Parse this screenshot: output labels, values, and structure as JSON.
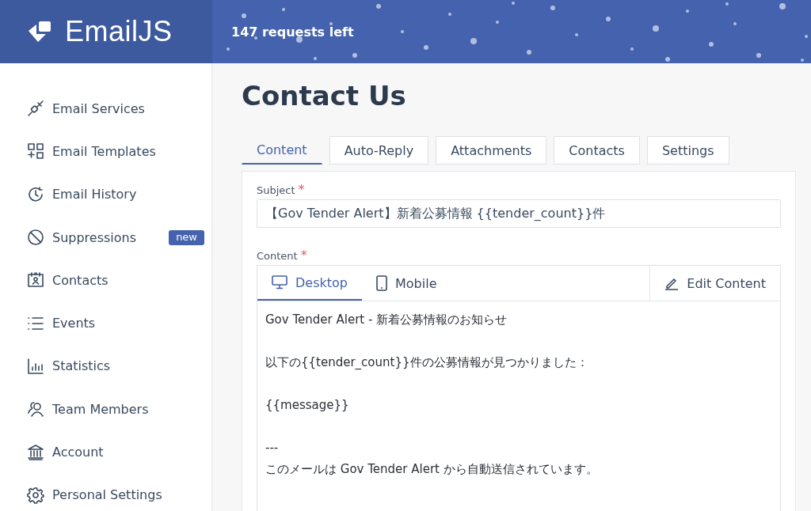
{
  "header": {
    "brand": "EmailJS",
    "requests": "147 requests left"
  },
  "sidebar": {
    "items": [
      {
        "kind": "plug",
        "label": "Email Services"
      },
      {
        "kind": "templates",
        "label": "Email Templates"
      },
      {
        "kind": "history",
        "label": "Email History"
      },
      {
        "kind": "ban",
        "label": "Suppressions",
        "badge": "new"
      },
      {
        "kind": "contacts",
        "label": "Contacts"
      },
      {
        "kind": "list",
        "label": "Events"
      },
      {
        "kind": "chart",
        "label": "Statistics"
      },
      {
        "kind": "team",
        "label": "Team Members"
      },
      {
        "kind": "bank",
        "label": "Account"
      },
      {
        "kind": "gear",
        "label": "Personal Settings"
      }
    ]
  },
  "page": {
    "title": "Contact Us"
  },
  "tabs": [
    {
      "label": "Content",
      "selected": true
    },
    {
      "label": "Auto-Reply",
      "selected": false
    },
    {
      "label": "Attachments",
      "selected": false
    },
    {
      "label": "Contacts",
      "selected": false
    },
    {
      "label": "Settings",
      "selected": false
    }
  ],
  "subject": {
    "label": "Subject",
    "required_mark": "*",
    "value": "【Gov Tender Alert】新着公募情報 {{tender_count}}件"
  },
  "content": {
    "label": "Content",
    "required_mark": "*",
    "preview_tabs": [
      {
        "kind": "desktop",
        "label": "Desktop",
        "selected": true
      },
      {
        "kind": "mobile",
        "label": "Mobile",
        "selected": false
      }
    ],
    "edit_button": "Edit Content",
    "paragraphs": [
      [
        "Gov Tender Alert - 新着公募情報のお知らせ"
      ],
      [
        "以下の{{tender_count}}件の公募情報が見つかりました："
      ],
      [
        "{{message}}"
      ],
      [
        "---",
        "このメールは Gov Tender Alert から自動送信されています。"
      ]
    ]
  }
}
